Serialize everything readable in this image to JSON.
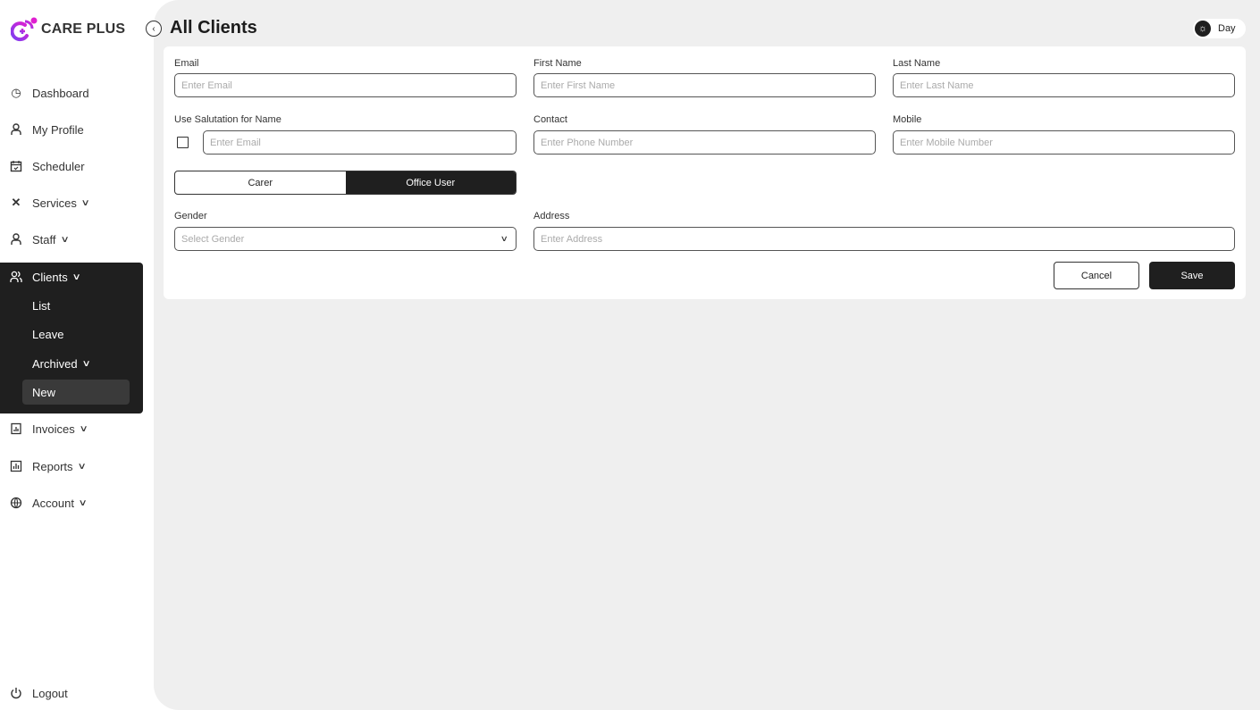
{
  "brand": {
    "name": "CARE PLUS",
    "colors": [
      "#7b3ff2",
      "#e01fd0"
    ]
  },
  "sidebar": {
    "items": [
      {
        "label": "Dashboard",
        "icon": "dashboard-gauge-icon"
      },
      {
        "label": "My Profile",
        "icon": "user-icon"
      },
      {
        "label": "Scheduler",
        "icon": "calendar-icon"
      },
      {
        "label": "Services",
        "icon": "tools-icon",
        "chevron": true
      },
      {
        "label": "Staff",
        "icon": "user-icon",
        "chevron": true
      },
      {
        "label": "Clients",
        "icon": "users-icon",
        "chevron": true
      },
      {
        "label": "Invoices",
        "icon": "invoice-icon",
        "chevron": true
      },
      {
        "label": "Reports",
        "icon": "chart-icon",
        "chevron": true
      },
      {
        "label": "Account",
        "icon": "globe-icon",
        "chevron": true
      }
    ],
    "clients_sub": [
      "List",
      "Leave",
      "Archived",
      "New"
    ],
    "active_sub": "New",
    "logout": "Logout"
  },
  "header": {
    "title": "All Clients",
    "theme_toggle": "Day"
  },
  "form": {
    "email": {
      "label": "Email",
      "placeholder": "Enter Email"
    },
    "first_name": {
      "label": "First Name",
      "placeholder": "Enter First Name"
    },
    "last_name": {
      "label": "Last Name",
      "placeholder": "Enter Last Name"
    },
    "salutation": {
      "label": "Use Salutation for Name",
      "placeholder": "Enter Email",
      "checked": false
    },
    "contact": {
      "label": "Contact",
      "placeholder": "Enter Phone Number"
    },
    "mobile": {
      "label": "Mobile",
      "placeholder": "Enter Mobile Number"
    },
    "user_type": {
      "options": [
        "Carer",
        "Office User"
      ],
      "selected": "Office User"
    },
    "gender": {
      "label": "Gender",
      "placeholder": "Select Gender"
    },
    "address": {
      "label": "Address",
      "placeholder": "Enter Address"
    },
    "cancel": "Cancel",
    "save": "Save"
  }
}
